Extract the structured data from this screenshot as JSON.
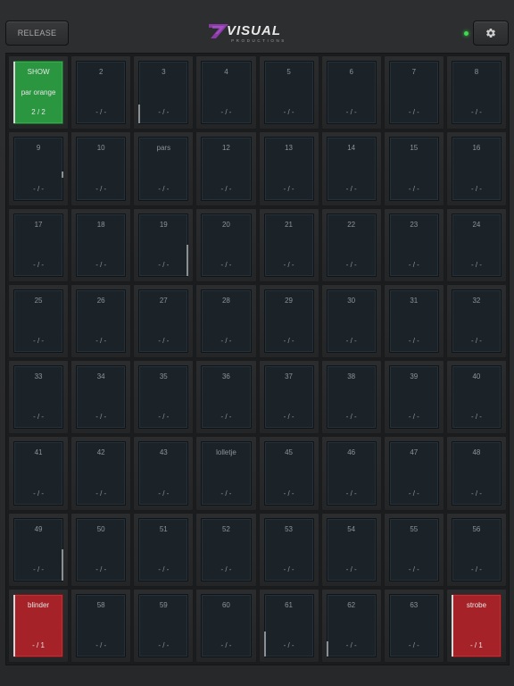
{
  "toolbar": {
    "release_label": "RELEASE",
    "logo_word": "VISUAL",
    "logo_sub": "PRODUCTIONS",
    "settings_icon": "gear-icon",
    "status_led_color": "#3ddc4b"
  },
  "colors": {
    "active_green": "#2a9640",
    "active_red": "#a52328",
    "pad_idle": "#1b2329",
    "logo_accent": "#8b3aa8"
  },
  "pads": [
    {
      "title": "SHOW",
      "sub": "par orange",
      "status": "2 / 2",
      "state": "green",
      "fader": 1.0
    },
    {
      "title": "2",
      "status": "- / -"
    },
    {
      "title": "3",
      "status": "- / -",
      "fader": 0.3
    },
    {
      "title": "4",
      "status": "- / -"
    },
    {
      "title": "5",
      "status": "- / -"
    },
    {
      "title": "6",
      "status": "- / -"
    },
    {
      "title": "7",
      "status": "- / -"
    },
    {
      "title": "8",
      "status": "- / -"
    },
    {
      "title": "9",
      "status": "- / -",
      "fader_right": 0.1
    },
    {
      "title": "10",
      "status": "- / -"
    },
    {
      "title": "pars",
      "status": "- / -"
    },
    {
      "title": "12",
      "status": "- / -"
    },
    {
      "title": "13",
      "status": "- / -"
    },
    {
      "title": "14",
      "status": "- / -"
    },
    {
      "title": "15",
      "status": "- / -"
    },
    {
      "title": "16",
      "status": "- / -"
    },
    {
      "title": "17",
      "status": "- / -"
    },
    {
      "title": "18",
      "status": "- / -"
    },
    {
      "title": "19",
      "status": "- / -",
      "fader_right": 0.5
    },
    {
      "title": "20",
      "status": "- / -"
    },
    {
      "title": "21",
      "status": "- / -"
    },
    {
      "title": "22",
      "status": "- / -"
    },
    {
      "title": "23",
      "status": "- / -"
    },
    {
      "title": "24",
      "status": "- / -"
    },
    {
      "title": "25",
      "status": "- / -"
    },
    {
      "title": "26",
      "status": "- / -"
    },
    {
      "title": "27",
      "status": "- / -"
    },
    {
      "title": "28",
      "status": "- / -"
    },
    {
      "title": "29",
      "status": "- / -"
    },
    {
      "title": "30",
      "status": "- / -"
    },
    {
      "title": "31",
      "status": "- / -"
    },
    {
      "title": "32",
      "status": "- / -"
    },
    {
      "title": "33",
      "status": "- / -"
    },
    {
      "title": "34",
      "status": "- / -"
    },
    {
      "title": "35",
      "status": "- / -"
    },
    {
      "title": "36",
      "status": "- / -"
    },
    {
      "title": "37",
      "status": "- / -"
    },
    {
      "title": "38",
      "status": "- / -"
    },
    {
      "title": "39",
      "status": "- / -"
    },
    {
      "title": "40",
      "status": "- / -"
    },
    {
      "title": "41",
      "status": "- / -"
    },
    {
      "title": "42",
      "status": "- / -"
    },
    {
      "title": "43",
      "status": "- / -"
    },
    {
      "title": "lolletje",
      "status": "- / -"
    },
    {
      "title": "45",
      "status": "- / -"
    },
    {
      "title": "46",
      "status": "- / -"
    },
    {
      "title": "47",
      "status": "- / -"
    },
    {
      "title": "48",
      "status": "- / -"
    },
    {
      "title": "49",
      "status": "- / -",
      "fader_right": 0.5
    },
    {
      "title": "50",
      "status": "- / -"
    },
    {
      "title": "51",
      "status": "- / -"
    },
    {
      "title": "52",
      "status": "- / -"
    },
    {
      "title": "53",
      "status": "- / -"
    },
    {
      "title": "54",
      "status": "- / -"
    },
    {
      "title": "55",
      "status": "- / -"
    },
    {
      "title": "56",
      "status": "- / -"
    },
    {
      "title": "blinder",
      "status": "- / 1",
      "state": "red",
      "fader": 1.0
    },
    {
      "title": "58",
      "status": "- / -"
    },
    {
      "title": "59",
      "status": "- / -"
    },
    {
      "title": "60",
      "status": "- / -"
    },
    {
      "title": "61",
      "status": "- / -",
      "fader": 0.4
    },
    {
      "title": "62",
      "status": "- / -",
      "fader": 0.25
    },
    {
      "title": "63",
      "status": "- / -"
    },
    {
      "title": "strobe",
      "status": "- / 1",
      "state": "red",
      "fader": 1.0
    }
  ]
}
